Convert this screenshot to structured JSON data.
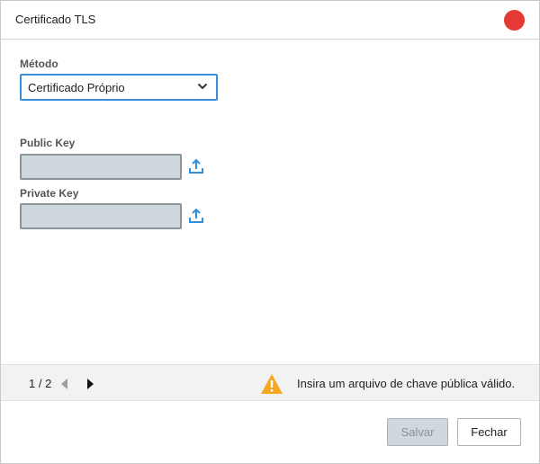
{
  "dialog": {
    "title": "Certificado TLS",
    "close_color": "#e53935"
  },
  "form": {
    "method_label": "Método",
    "method_value": "Certificado Próprio",
    "public_key_label": "Public Key",
    "private_key_label": "Private Key",
    "public_key_value": "",
    "private_key_value": ""
  },
  "status": {
    "page": "1 / 2",
    "message": "Insira um arquivo de chave pública válido.",
    "warning_color": "#f5a623"
  },
  "footer": {
    "save_label": "Salvar",
    "close_label": "Fechar"
  },
  "colors": {
    "accent": "#3b8fd9",
    "upload_icon": "#2f8fd8",
    "input_bg": "#cfd8dc"
  },
  "icons": {
    "close": "close-dot-icon",
    "dropdown": "chevron-down-icon",
    "upload": "upload-icon",
    "prev": "caret-left-icon",
    "next": "caret-right-icon",
    "warning": "warning-triangle-icon"
  }
}
